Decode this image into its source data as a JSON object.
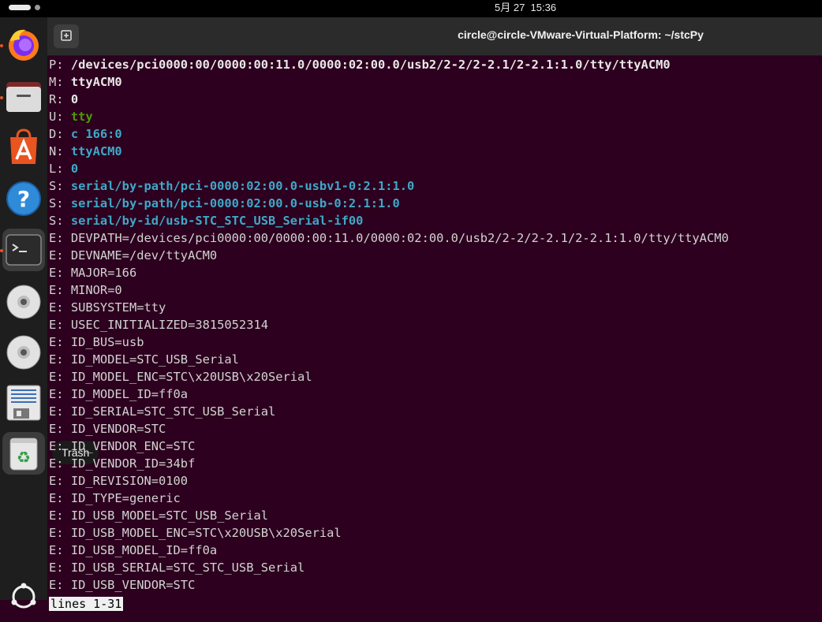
{
  "topbar": {
    "clock": "5月 27  15:36"
  },
  "window": {
    "title": "circle@circle-VMware-Virtual-Platform: ~/stcPy"
  },
  "dock": {
    "items": [
      {
        "name": "firefox-icon"
      },
      {
        "name": "files-icon"
      },
      {
        "name": "app-center-icon"
      },
      {
        "name": "help-icon"
      },
      {
        "name": "terminal-icon"
      },
      {
        "name": "disc-icon"
      },
      {
        "name": "disc-icon"
      },
      {
        "name": "text-editor-icon"
      },
      {
        "name": "trash-icon"
      },
      {
        "name": "show-apps-icon"
      }
    ],
    "tooltip": "Trash"
  },
  "terminal": {
    "lines": [
      {
        "prefix": "P: ",
        "value": "/devices/pci0000:00/0000:00:11.0/0000:02:00.0/usb2/2-2/2-2.1/2-2.1:1.0/tty/ttyACM0",
        "style": "bw"
      },
      {
        "prefix": "M: ",
        "value": "ttyACM0",
        "style": "bw"
      },
      {
        "prefix": "R: ",
        "value": "0",
        "style": "bw"
      },
      {
        "prefix": "U: ",
        "value": "tty",
        "style": "bg"
      },
      {
        "prefix": "D: ",
        "value": "c 166:0",
        "style": "bc"
      },
      {
        "prefix": "N: ",
        "value": "ttyACM0",
        "style": "bc"
      },
      {
        "prefix": "L: ",
        "value": "0",
        "style": "bc"
      },
      {
        "prefix": "S: ",
        "value": "serial/by-path/pci-0000:02:00.0-usbv1-0:2.1:1.0",
        "style": "bc"
      },
      {
        "prefix": "S: ",
        "value": "serial/by-path/pci-0000:02:00.0-usb-0:2.1:1.0",
        "style": "bc"
      },
      {
        "prefix": "S: ",
        "value": "serial/by-id/usb-STC_STC_USB_Serial-if00",
        "style": "bc"
      },
      {
        "prefix": "E: ",
        "value": "DEVPATH=/devices/pci0000:00/0000:00:11.0/0000:02:00.0/usb2/2-2/2-2.1/2-2.1:1.0/tty/ttyACM0",
        "style": "n"
      },
      {
        "prefix": "E: ",
        "value": "DEVNAME=/dev/ttyACM0",
        "style": "n"
      },
      {
        "prefix": "E: ",
        "value": "MAJOR=166",
        "style": "n"
      },
      {
        "prefix": "E: ",
        "value": "MINOR=0",
        "style": "n"
      },
      {
        "prefix": "E: ",
        "value": "SUBSYSTEM=tty",
        "style": "n"
      },
      {
        "prefix": "E: ",
        "value": "USEC_INITIALIZED=3815052314",
        "style": "n"
      },
      {
        "prefix": "E: ",
        "value": "ID_BUS=usb",
        "style": "n"
      },
      {
        "prefix": "E: ",
        "value": "ID_MODEL=STC_USB_Serial",
        "style": "n"
      },
      {
        "prefix": "E: ",
        "value": "ID_MODEL_ENC=STC\\x20USB\\x20Serial",
        "style": "n"
      },
      {
        "prefix": "E: ",
        "value": "ID_MODEL_ID=ff0a",
        "style": "n"
      },
      {
        "prefix": "E: ",
        "value": "ID_SERIAL=STC_STC_USB_Serial",
        "style": "n"
      },
      {
        "prefix": "E: ",
        "value": "ID_VENDOR=STC",
        "style": "n"
      },
      {
        "prefix": "E: ",
        "value": "ID_VENDOR_ENC=STC",
        "style": "n"
      },
      {
        "prefix": "E: ",
        "value": "ID_VENDOR_ID=34bf",
        "style": "n"
      },
      {
        "prefix": "E: ",
        "value": "ID_REVISION=0100",
        "style": "n"
      },
      {
        "prefix": "E: ",
        "value": "ID_TYPE=generic",
        "style": "n"
      },
      {
        "prefix": "E: ",
        "value": "ID_USB_MODEL=STC_USB_Serial",
        "style": "n"
      },
      {
        "prefix": "E: ",
        "value": "ID_USB_MODEL_ENC=STC\\x20USB\\x20Serial",
        "style": "n"
      },
      {
        "prefix": "E: ",
        "value": "ID_USB_MODEL_ID=ff0a",
        "style": "n"
      },
      {
        "prefix": "E: ",
        "value": "ID_USB_SERIAL=STC_STC_USB_Serial",
        "style": "n"
      },
      {
        "prefix": "E: ",
        "value": "ID_USB_VENDOR=STC",
        "style": "n"
      }
    ],
    "pager_status": "lines 1-31"
  }
}
